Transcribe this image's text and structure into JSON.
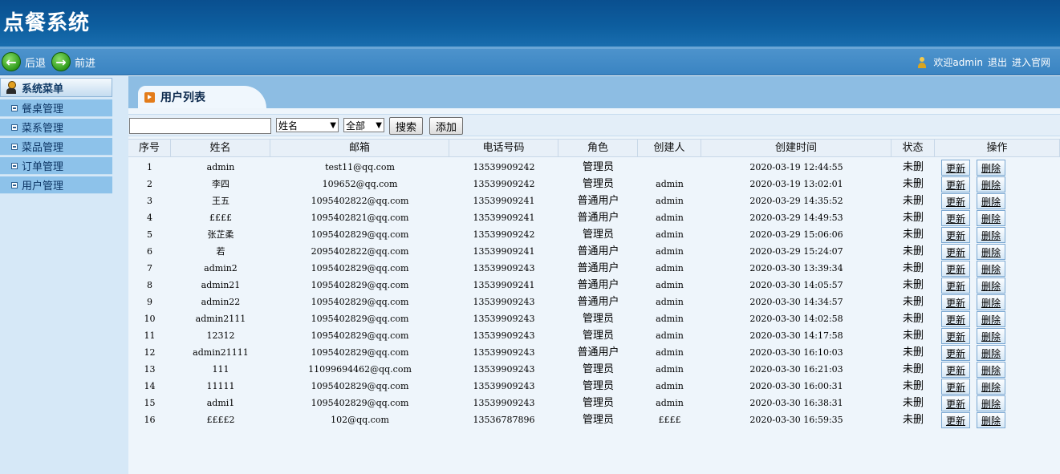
{
  "app": {
    "title": "点餐系统"
  },
  "nav": {
    "back_label": "后退",
    "forward_label": "前进",
    "welcome": "欢迎admin",
    "logout": "退出",
    "site": "进入官网"
  },
  "sidebar": {
    "header": "系统菜单",
    "items": [
      {
        "label": "餐桌管理"
      },
      {
        "label": "菜系管理"
      },
      {
        "label": "菜品管理"
      },
      {
        "label": "订单管理"
      },
      {
        "label": "用户管理"
      }
    ]
  },
  "main": {
    "tab_title": "用户列表",
    "search": {
      "value": "",
      "placeholder": ""
    },
    "field_select": "姓名",
    "status_select": "全部",
    "search_button": "搜索",
    "add_button": "添加"
  },
  "table": {
    "headers": [
      "序号",
      "姓名",
      "邮箱",
      "电话号码",
      "角色",
      "创建人",
      "创建时间",
      "状态",
      "操作"
    ],
    "update_label": "更新",
    "delete_label": "删除",
    "rows": [
      {
        "no": "1",
        "name": "admin",
        "email": "test11@qq.com",
        "phone": "13539909242",
        "role": "管理员",
        "creator": "",
        "created": "2020-03-19 12:44:55",
        "status": "未删"
      },
      {
        "no": "2",
        "name": "李四",
        "email": "109652@qq.com",
        "phone": "13539909242",
        "role": "管理员",
        "creator": "admin",
        "created": "2020-03-19 13:02:01",
        "status": "未删"
      },
      {
        "no": "3",
        "name": "王五",
        "email": "1095402822@qq.com",
        "phone": "13539909241",
        "role": "普通用户",
        "creator": "admin",
        "created": "2020-03-29 14:35:52",
        "status": "未删"
      },
      {
        "no": "4",
        "name": "££££",
        "email": "1095402821@qq.com",
        "phone": "13539909241",
        "role": "普通用户",
        "creator": "admin",
        "created": "2020-03-29 14:49:53",
        "status": "未删"
      },
      {
        "no": "5",
        "name": "张芷柔",
        "email": "1095402829@qq.com",
        "phone": "13539909242",
        "role": "管理员",
        "creator": "admin",
        "created": "2020-03-29 15:06:06",
        "status": "未删"
      },
      {
        "no": "6",
        "name": "若",
        "email": "2095402822@qq.com",
        "phone": "13539909241",
        "role": "普通用户",
        "creator": "admin",
        "created": "2020-03-29 15:24:07",
        "status": "未删"
      },
      {
        "no": "7",
        "name": "admin2",
        "email": "1095402829@qq.com",
        "phone": "13539909243",
        "role": "普通用户",
        "creator": "admin",
        "created": "2020-03-30 13:39:34",
        "status": "未删"
      },
      {
        "no": "8",
        "name": "admin21",
        "email": "1095402829@qq.com",
        "phone": "13539909241",
        "role": "普通用户",
        "creator": "admin",
        "created": "2020-03-30 14:05:57",
        "status": "未删"
      },
      {
        "no": "9",
        "name": "admin22",
        "email": "1095402829@qq.com",
        "phone": "13539909243",
        "role": "普通用户",
        "creator": "admin",
        "created": "2020-03-30 14:34:57",
        "status": "未删"
      },
      {
        "no": "10",
        "name": "admin2111",
        "email": "1095402829@qq.com",
        "phone": "13539909243",
        "role": "管理员",
        "creator": "admin",
        "created": "2020-03-30 14:02:58",
        "status": "未删"
      },
      {
        "no": "11",
        "name": "12312",
        "email": "1095402829@qq.com",
        "phone": "13539909243",
        "role": "管理员",
        "creator": "admin",
        "created": "2020-03-30 14:17:58",
        "status": "未删"
      },
      {
        "no": "12",
        "name": "admin21111",
        "email": "1095402829@qq.com",
        "phone": "13539909243",
        "role": "普通用户",
        "creator": "admin",
        "created": "2020-03-30 16:10:03",
        "status": "未删"
      },
      {
        "no": "13",
        "name": "111",
        "email": "11099694462@qq.com",
        "phone": "13539909243",
        "role": "管理员",
        "creator": "admin",
        "created": "2020-03-30 16:21:03",
        "status": "未删"
      },
      {
        "no": "14",
        "name": "11111",
        "email": "1095402829@qq.com",
        "phone": "13539909243",
        "role": "管理员",
        "creator": "admin",
        "created": "2020-03-30 16:00:31",
        "status": "未删"
      },
      {
        "no": "15",
        "name": "admi1",
        "email": "1095402829@qq.com",
        "phone": "13539909243",
        "role": "管理员",
        "creator": "admin",
        "created": "2020-03-30 16:38:31",
        "status": "未删"
      },
      {
        "no": "16",
        "name": "££££2",
        "email": "102@qq.com",
        "phone": "13536787896",
        "role": "管理员",
        "creator": "££££",
        "created": "2020-03-30 16:59:35",
        "status": "未删"
      }
    ]
  }
}
